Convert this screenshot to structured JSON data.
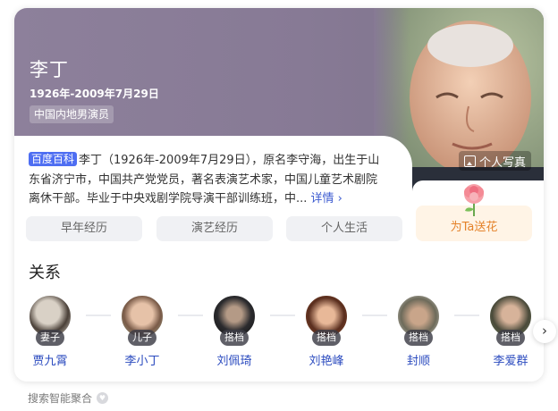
{
  "person": {
    "name": "李丁",
    "dates": "1926年-2009年7月29日",
    "occupation": "中国内地男演员"
  },
  "photo_button": {
    "label": "个人写真",
    "icon": "photo-icon"
  },
  "summary": {
    "badge": "百度百科",
    "text": "李丁（1926年-2009年7月29日），原名李守海，出生于山东省济宁市，中国共产党党员，著名表演艺术家，中国儿童艺术剧院离休干部。毕业于中央戏剧学院导演干部训练班，中...",
    "more": "详情 ›"
  },
  "flower_button": {
    "label": "为Ta送花",
    "icon": "rose-icon"
  },
  "tabs": [
    {
      "label": "早年经历"
    },
    {
      "label": "演艺经历"
    },
    {
      "label": "个人生活"
    }
  ],
  "relations": {
    "title": "关系",
    "items": [
      {
        "role": "妻子",
        "name": "贾九霄"
      },
      {
        "role": "儿子",
        "name": "李小丁"
      },
      {
        "role": "搭档",
        "name": "刘佩琦"
      },
      {
        "role": "搭档",
        "name": "刘艳峰"
      },
      {
        "role": "搭档",
        "name": "封顺"
      },
      {
        "role": "搭档",
        "name": "李爱群"
      }
    ],
    "next_icon": "chevron-right-icon"
  },
  "footer": {
    "label": "搜索智能聚合",
    "icon": "heart-icon"
  },
  "colors": {
    "hero_bg": "#877a95",
    "link": "#2b4bbf",
    "badge": "#4e6ef2",
    "flower_bg": "#fff4e6",
    "flower_text": "#e4822a"
  }
}
